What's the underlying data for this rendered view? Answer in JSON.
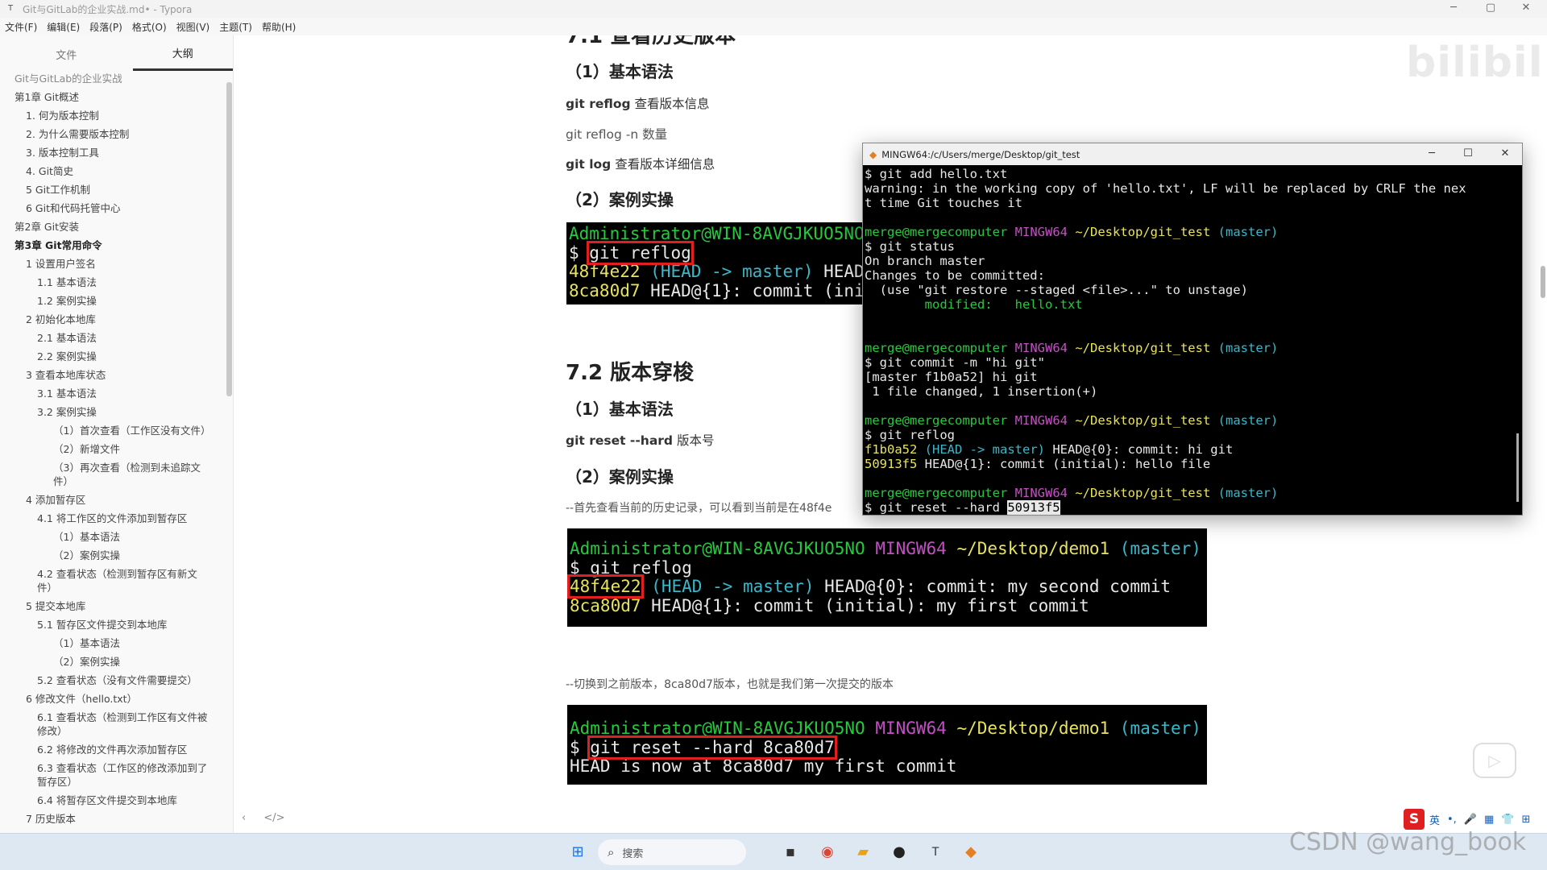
{
  "window": {
    "title": "Git与GitLab的企业实战.md• - Typora",
    "app_icon": "T",
    "controls": [
      "─",
      "▢",
      "✕"
    ]
  },
  "menu": [
    "文件(F)",
    "编辑(E)",
    "段落(P)",
    "格式(O)",
    "视图(V)",
    "主题(T)",
    "帮助(H)"
  ],
  "sidebar": {
    "tabs": [
      "文件",
      "大纲"
    ],
    "outline": [
      "Git与GitLab的企业实战",
      "第1章 Git概述",
      "1. 何为版本控制",
      "2. 为什么需要版本控制",
      "3. 版本控制工具",
      "4. Git简史",
      "5 Git工作机制",
      "6 Git和代码托管中心",
      "第2章 Git安装",
      "第3章 Git常用命令",
      "1 设置用户签名",
      "1.1 基本语法",
      "1.2 案例实操",
      "2 初始化本地库",
      "2.1 基本语法",
      "2.2 案例实操",
      "3 查看本地库状态",
      "3.1 基本语法",
      "3.2 案例实操",
      "（1）首次查看（工作区没有文件）",
      "（2）新增文件",
      "（3）再次查看（检测到未追踪文件）",
      "4 添加暂存区",
      "4.1 将工作区的文件添加到暂存区",
      "（1）基本语法",
      "（2）案例实操",
      "4.2 查看状态（检测到暂存区有新文件）",
      "5 提交本地库",
      "5.1 暂存区文件提交到本地库",
      "（1）基本语法",
      "（2）案例实操",
      "5.2 查看状态（没有文件需要提交）",
      "6 修改文件（hello.txt）",
      "6.1 查看状态（检测到工作区有文件被修改）",
      "6.2 将修改的文件再次添加暂存区",
      "6.3 查看状态（工作区的修改添加到了暂存区）",
      "6.4 将暂存区文件提交到本地库",
      "7 历史版本"
    ],
    "footer": [
      "‹",
      "</>"
    ]
  },
  "doc": {
    "h2_top": "7.1 查看历史版本",
    "s1_h3": "（1）基本语法",
    "s1_l1_cmd": "git reflog",
    "s1_l1_desc": "查看版本信息",
    "s1_l2": "git reflog -n 数量",
    "s1_l3_cmd": "git log",
    "s1_l3_desc": "查看版本详细信息",
    "s1_h3b": "（2）案例实操",
    "term1": {
      "l1": "Administrator@WIN-8AVGJKUO5NO M",
      "l2_prompt": "$ ",
      "l2_cmd": "git reflog",
      "l3_hash": "48f4e22",
      "l3_ref": "(HEAD -> master)",
      "l3_rest": " HEAD@",
      "l4_hash": "8ca80d7",
      "l4_rest": " HEAD@{1}: commit (init"
    },
    "h2_72": "7.2 版本穿梭",
    "s2_h3": "（1）基本语法",
    "s2_l1_cmd": "git reset --hard",
    "s2_l1_desc": "版本号",
    "s2_h3b": "（2）案例实操",
    "s2_note1": "--首先查看当前的历史记录，可以看到当前是在48f4e",
    "term2": {
      "user": "Administrator@WIN-8AVGJKUO5NO",
      "env": "MINGW64",
      "path": "~/Desktop/demo1",
      "branch": "(master)",
      "cmd_line": "$ git reflog",
      "hash1": "48f4e22",
      "ref1": "(HEAD -> master)",
      "rest1": " HEAD@{0}: commit: my second commit",
      "hash2": "8ca80d7",
      "rest2": " HEAD@{1}: commit (initial): my first commit"
    },
    "s2_note2": "--切换到之前版本，8ca80d7版本，也就是我们第一次提交的版本",
    "term3": {
      "user": "Administrator@WIN-8AVGJKUO5NO",
      "env": "MINGW64",
      "path": "~/Desktop/demo1",
      "branch": "(master)",
      "prompt": "$ ",
      "cmd": "git reset --hard 8ca80d7",
      "out": "HEAD is now at 8ca80d7 my first commit"
    }
  },
  "mingw": {
    "title": "MINGW64:/c/Users/merge/Desktop/git_test",
    "controls": [
      "─",
      "☐",
      "✕"
    ],
    "user": "merge@mergecomputer",
    "env": "MINGW64",
    "path": "~/Desktop/git_test",
    "branch": "(master)",
    "l1": "$ git add hello.txt",
    "l2": "warning: in the working copy of 'hello.txt', LF will be replaced by CRLF the nex",
    "l3": "t time Git touches it",
    "l5": "$ git status",
    "l6": "On branch master",
    "l7": "Changes to be committed:",
    "l8": "  (use \"git restore --staged <file>...\" to unstage)",
    "l9": "        modified:   hello.txt",
    "l13": "$ git commit -m \"hi git\"",
    "l14": "[master f1b0a52] hi git",
    "l15": " 1 file changed, 1 insertion(+)",
    "l18": "$ git reflog",
    "l19_hash": "f1b0a52",
    "l19_ref": "(HEAD -> master)",
    "l19_rest": " HEAD@{0}: commit: hi git",
    "l20_hash": "50913f5",
    "l20_rest": " HEAD@{1}: commit (initial): hello file",
    "l23_prompt": "$ git reset --hard ",
    "l23_sel": "50913f5"
  },
  "watermark": "bilibili",
  "ime": {
    "logo": "S",
    "items": [
      "英",
      "•,",
      "🎤",
      "▦",
      "👕",
      "⊞"
    ]
  },
  "taskbar": {
    "search": "搜索",
    "csdn": "CSDN @wang_book"
  }
}
